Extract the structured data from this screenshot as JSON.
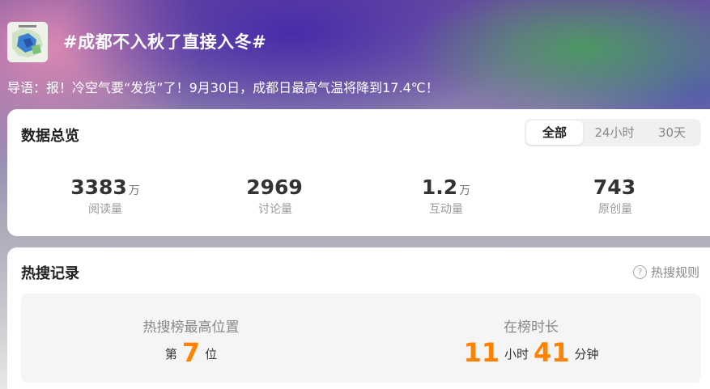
{
  "header": {
    "title": "#成都不入秋了直接入冬#",
    "intro": "导语：报！冷空气要“发货”了！9月30日，成都日最高气温将降到17.4℃！"
  },
  "overview": {
    "title": "数据总览",
    "tabs": [
      {
        "label": "全部",
        "active": true
      },
      {
        "label": "24小时",
        "active": false
      },
      {
        "label": "30天",
        "active": false
      }
    ],
    "stats": [
      {
        "value": "3383",
        "unit": "万",
        "label": "阅读量"
      },
      {
        "value": "2969",
        "unit": "",
        "label": "讨论量"
      },
      {
        "value": "1.2",
        "unit": "万",
        "label": "互动量"
      },
      {
        "value": "743",
        "unit": "",
        "label": "原创量"
      }
    ]
  },
  "hot_search": {
    "title": "热搜记录",
    "rules_label": "热搜规则",
    "help_icon": "question-circle-icon",
    "highest_position": {
      "label": "热搜榜最高位置",
      "prefix": "第",
      "value": "7",
      "suffix": "位"
    },
    "duration": {
      "label": "在榜时长",
      "hours": "11",
      "hours_unit": "小时",
      "minutes": "41",
      "minutes_unit": "分钟"
    }
  },
  "colors": {
    "accent_orange": "#ff8200",
    "card_bg": "#ffffff",
    "panel_bg": "#f5f5f5"
  }
}
